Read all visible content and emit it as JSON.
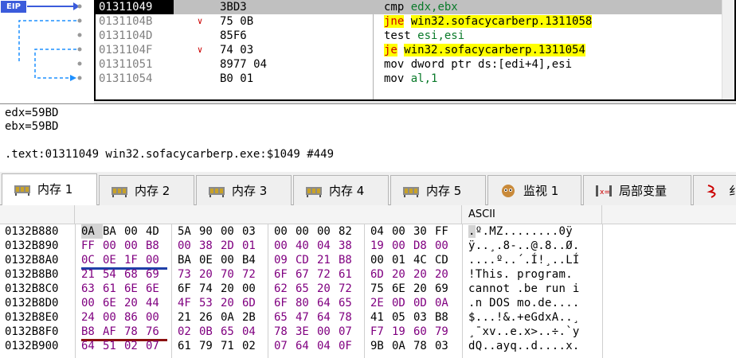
{
  "disasm": {
    "eip_label": "EIP",
    "rows": [
      {
        "addr": "01311049",
        "bytes": "3BD3",
        "mnemonic": "cmp",
        "operands": "edx,ebx",
        "selected": true,
        "jump": false,
        "arrow": ""
      },
      {
        "addr": "0131104B",
        "bytes": "75 0B",
        "mnemonic": "jne",
        "operands": "win32.sofacycarberp.1311058",
        "selected": false,
        "jump": true,
        "arrow": "v"
      },
      {
        "addr": "0131104D",
        "bytes": "85F6",
        "mnemonic": "test",
        "operands": "esi,esi",
        "selected": false,
        "jump": false,
        "arrow": ""
      },
      {
        "addr": "0131104F",
        "bytes": "74 03",
        "mnemonic": "je",
        "operands": "win32.sofacycarberp.1311054",
        "selected": false,
        "jump": true,
        "arrow": "v"
      },
      {
        "addr": "01311051",
        "bytes": "8977 04",
        "mnemonic": "mov",
        "operands": "dword ptr ds:[edi+4],esi",
        "selected": false,
        "jump": false,
        "arrow": ""
      },
      {
        "addr": "01311054",
        "bytes": "B0 01",
        "mnemonic": "mov",
        "operands": "al,1",
        "selected": false,
        "jump": false,
        "arrow": ""
      }
    ]
  },
  "info": {
    "line1": "edx=59BD",
    "line2": "ebx=59BD",
    "line3": ".text:01311049 win32.sofacycarberp.exe:$1049 #449"
  },
  "tabs": [
    {
      "label": "内存 1",
      "icon": "memory-icon",
      "active": true
    },
    {
      "label": "内存 2",
      "icon": "memory-icon",
      "active": false
    },
    {
      "label": "内存 3",
      "icon": "memory-icon",
      "active": false
    },
    {
      "label": "内存 4",
      "icon": "memory-icon",
      "active": false
    },
    {
      "label": "内存 5",
      "icon": "memory-icon",
      "active": false
    },
    {
      "label": "监视 1",
      "icon": "watch-icon",
      "active": false
    },
    {
      "label": "局部变量",
      "icon": "locals-icon",
      "active": false
    },
    {
      "label": "纟",
      "icon": "struct-icon",
      "active": false
    }
  ],
  "dump": {
    "ascii_header": "ASCII",
    "rows": [
      {
        "addr": "0132B880",
        "hex": [
          "0A",
          "BA",
          "00",
          "4D",
          "5A",
          "90",
          "00",
          "03",
          "00",
          "00",
          "00",
          "82",
          "04",
          "00",
          "30",
          "FF"
        ],
        "ascii": ".º.MZ........0ÿ"
      },
      {
        "addr": "0132B890",
        "hex": [
          "FF",
          "00",
          "00",
          "B8",
          "00",
          "38",
          "2D",
          "01",
          "00",
          "40",
          "04",
          "38",
          "19",
          "00",
          "D8",
          "00"
        ],
        "ascii": "ÿ..¸.8-..@.8..Ø."
      },
      {
        "addr": "0132B8A0",
        "hex": [
          "0C",
          "0E",
          "1F",
          "00",
          "BA",
          "0E",
          "00",
          "B4",
          "09",
          "CD",
          "21",
          "B8",
          "00",
          "01",
          "4C",
          "CD"
        ],
        "ascii": "....º..´.Í!¸..LÍ"
      },
      {
        "addr": "0132B8B0",
        "hex": [
          "21",
          "54",
          "68",
          "69",
          "73",
          "20",
          "70",
          "72",
          "6F",
          "67",
          "72",
          "61",
          "6D",
          "20",
          "20",
          "20"
        ],
        "ascii": "!This. program."
      },
      {
        "addr": "0132B8C0",
        "hex": [
          "63",
          "61",
          "6E",
          "6E",
          "6F",
          "74",
          "20",
          "00",
          "62",
          "65",
          "20",
          "72",
          "75",
          "6E",
          "20",
          "69"
        ],
        "ascii": "cannot .be run i"
      },
      {
        "addr": "0132B8D0",
        "hex": [
          "00",
          "6E",
          "20",
          "44",
          "4F",
          "53",
          "20",
          "6D",
          "6F",
          "80",
          "64",
          "65",
          "2E",
          "0D",
          "0D",
          "0A"
        ],
        "ascii": ".n DOS mo.de...."
      },
      {
        "addr": "0132B8E0",
        "hex": [
          "24",
          "00",
          "86",
          "00",
          "21",
          "26",
          "0A",
          "2B",
          "65",
          "47",
          "64",
          "78",
          "41",
          "05",
          "03",
          "B8"
        ],
        "ascii": "$...!&.+eGdxA..¸"
      },
      {
        "addr": "0132B8F0",
        "hex": [
          "B8",
          "AF",
          "78",
          "76",
          "02",
          "0B",
          "65",
          "04",
          "78",
          "3E",
          "00",
          "07",
          "F7",
          "19",
          "60",
          "79"
        ],
        "ascii": "¸¯xv..e.x>..÷.`y"
      },
      {
        "addr": "0132B900",
        "hex": [
          "64",
          "51",
          "02",
          "07",
          "61",
          "79",
          "71",
          "02",
          "07",
          "64",
          "04",
          "0F",
          "9B",
          "0A",
          "78",
          "03"
        ],
        "ascii": "dQ..ayq..d....x."
      }
    ]
  },
  "colors": {
    "eip_tag": "#3b5bdb",
    "jump_highlight": "#ffff00",
    "jump_mnemonic": "#cc0000",
    "register": "#0a7a2a",
    "segment": "#b8860b",
    "selected_row": "#c0c0c0",
    "hex_address_purple": "#800080"
  }
}
